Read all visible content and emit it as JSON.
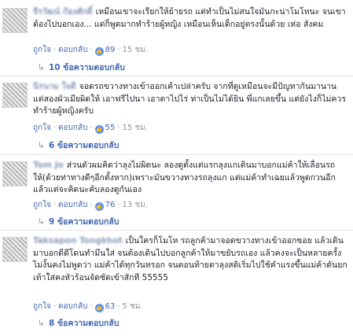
{
  "comments": [
    {
      "author": "จีรวัฒน์ ก้องศักดิ์",
      "text": "เหมือนเขาจะเรียกให้ย้ายรถ แต่ทำเป็นไม่สนใจมันกะน่าโมโหนะ จนเขาต้องไปบอกเอง... แต่ก็พูดมากทำร้ายผู้หญิง เหมือนเห็นเด็กอยู่ตรงนั้นด้วย เห่อ สังคม",
      "like_label": "ถูกใจ",
      "reply_label": "ตอบกลับ",
      "likes": "89",
      "time": "15 ชม.",
      "replies": "10 ข้อความตอบกลับ"
    },
    {
      "author": "นิรนาม ใจดี",
      "text": "จอดรถขวางทางเข้าออกเค้าเปล่าครับ จากที่ดูเหมือนจะมีปัญหากันมานาน แต่สองผัวเมียผิดให้ เอาฟรีไปนา เอาตาไปไร่ ท่าเป็นไม่ได้ยิน พี่แกเลยขึ้น แต่ยังไงก็ไม่ควรทำร้ายผู้หญิงครับ",
      "like_label": "ถูกใจ",
      "reply_label": "ตอบกลับ",
      "likes": "55",
      "time": "15 ชม.",
      "replies": "6 ข้อความตอบกลับ"
    },
    {
      "author": "Tom Jo",
      "text": "ส่วนตัวผมคิดว่าลุงไม่ผิดนะ ลองดูตั้งแต่แรกลุงแกเดินมาบอกแม่ค้าให้เลื่อนรถให้(ด้วยท่าทางดีๆอีกตั้งหาก)เพราะมันขวางทางรถลุงแก แต่แม่ค้าทำเฉยแล้วพูดกวนอีก แล้วแต่จะคิดนะคับลองดูกันเอง",
      "like_label": "ถูกใจ",
      "reply_label": "ตอบกลับ",
      "likes": "76",
      "time": "13 ชม.",
      "replies": "9 ข้อความตอบกลับ"
    },
    {
      "author": "Taksapon Tongkhot",
      "text": "เป็นใครก็โมโห รถลูกค้ามาจอดขวางทางเข้าออกซอย แล้วเดินมาบอกดีดีโดนทำมึนใส่ จนต้องเดินไปบอกลูกค้าให้มาขยับรถเอง แล้วคงจะเป็นหลายครั้งไม่งั้นคงไม่พูดว่า แม่ค้าได้ทุกวันหรอก จนตอนท้ายตาลุงสติเริ่มไปใช้คำแรงขึ้นแม่ค้าดันยกเท้าใส่คงหัวร้อนจัดซัดเข้าสักที 55555",
      "like_label": "ถูกใจ",
      "reply_label": "ตอบกลับ",
      "likes": "63",
      "time": "5 ชม.",
      "replies": "8 ข้อความตอบกลับ"
    }
  ],
  "icons": {
    "like": "thumbs-up-icon",
    "reply": "reply-arrow-icon"
  },
  "colors": {
    "link": "#4267b2",
    "meta": "#90949c",
    "like_badge": "#5890ff"
  }
}
